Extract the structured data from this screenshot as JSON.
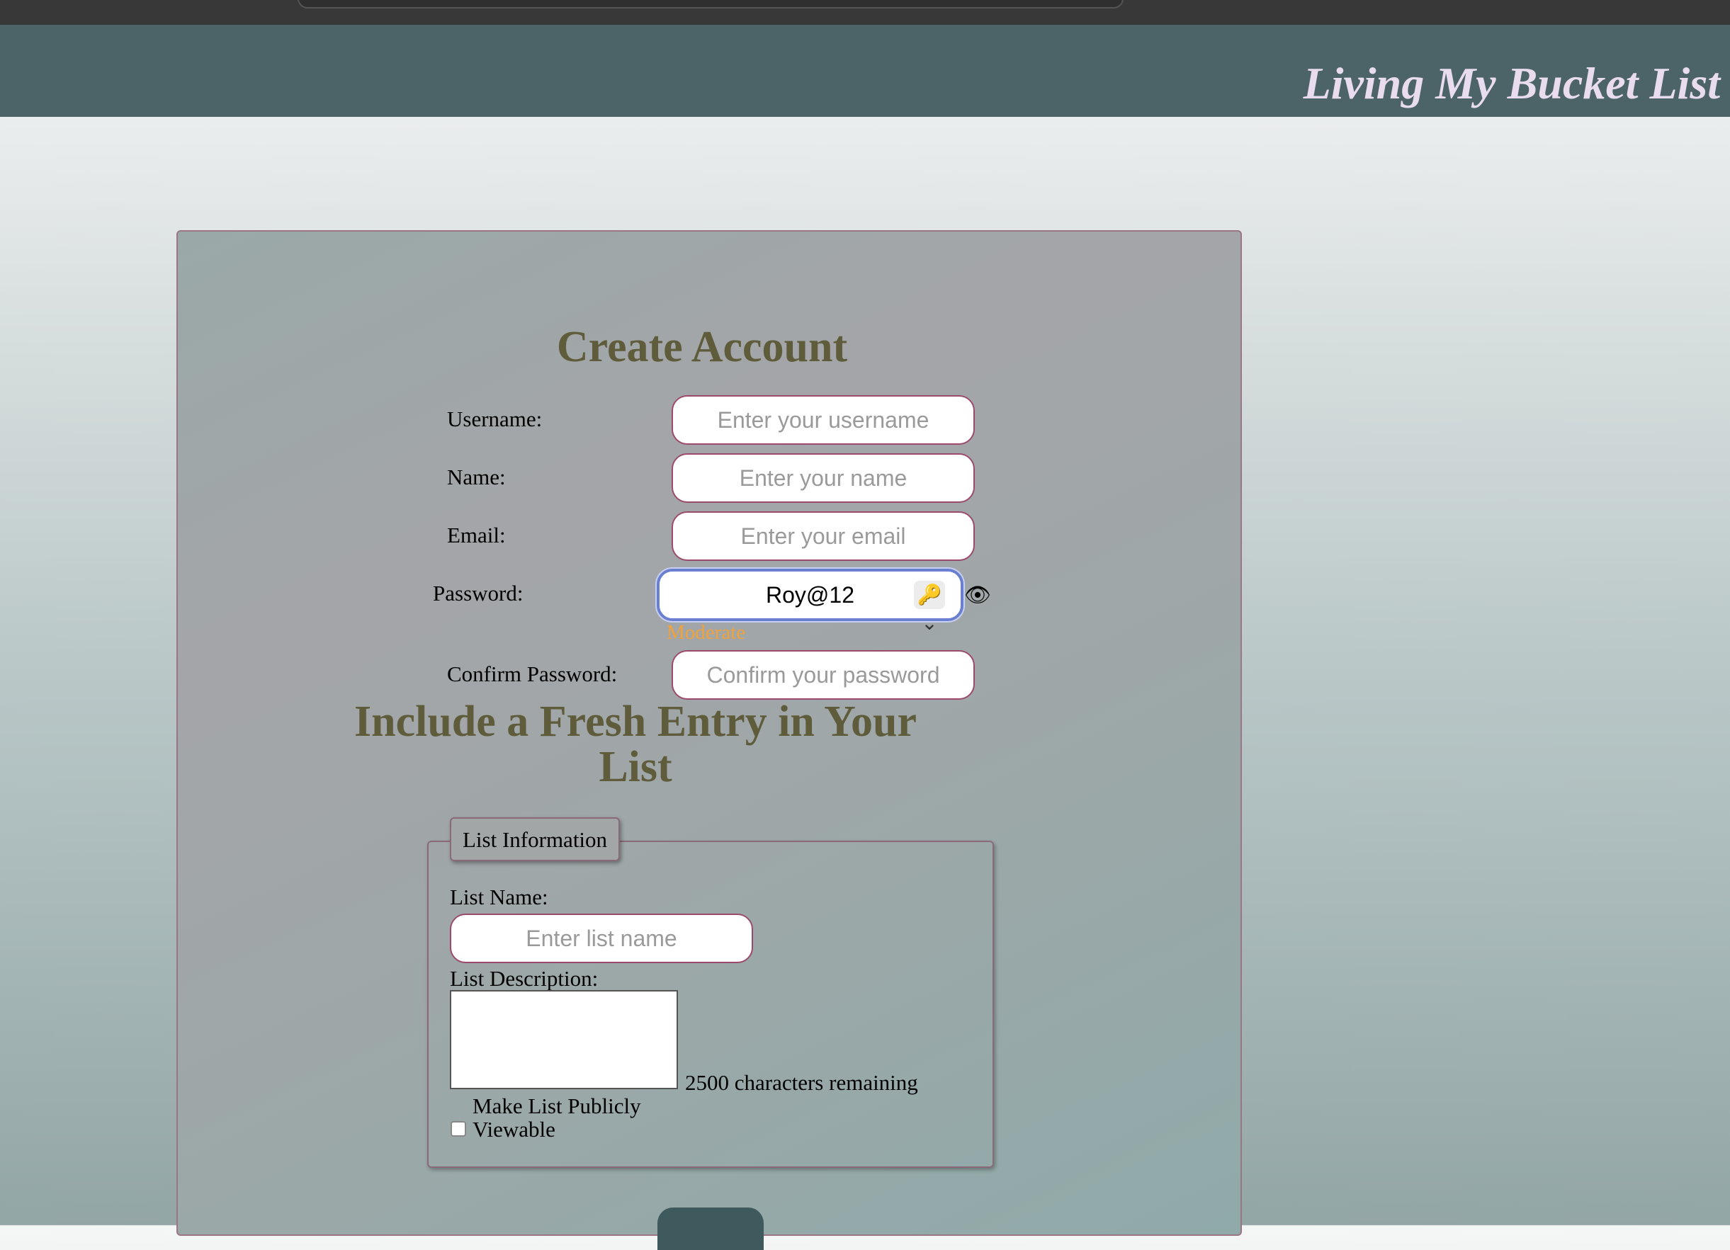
{
  "site": {
    "title": "Living My Bucket List"
  },
  "form": {
    "title": "Create Account",
    "username": {
      "label": "Username:",
      "placeholder": "Enter your username"
    },
    "name": {
      "label": "Name:",
      "placeholder": "Enter your name"
    },
    "email": {
      "label": "Email:",
      "placeholder": "Enter your email"
    },
    "password": {
      "label": "Password:",
      "value": "Roy@12",
      "strength": "Moderate",
      "strength_color": "#f2a23a",
      "key_icon": "🔑⌄",
      "eye_icon": "👁"
    },
    "confirm": {
      "label": "Confirm Password:",
      "placeholder": "Confirm your password"
    }
  },
  "list": {
    "title": "Include a Fresh Entry in Your List",
    "legend": "List Information",
    "name_label": "List Name:",
    "name_placeholder": "Enter list name",
    "desc_label": "List Description:",
    "chars_remaining": "2500 characters remaining",
    "public_label": "Make List Publicly Viewable",
    "public_checked": false
  },
  "colors": {
    "header": "#4c6467",
    "title_text": "#5f5c3c",
    "field_border": "#9b4a6c",
    "button": "#3f5a5c"
  }
}
